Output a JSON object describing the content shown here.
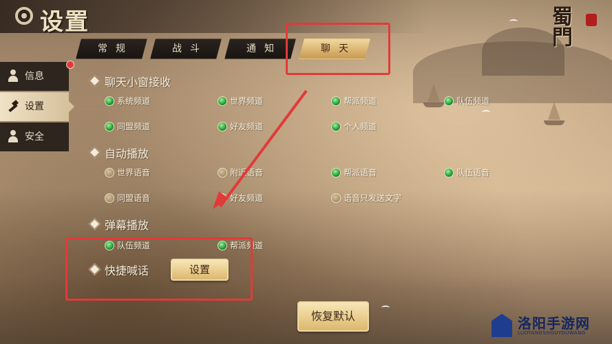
{
  "header": {
    "title": "设置",
    "logo_text": "蜀門"
  },
  "tabs": [
    {
      "label": "常规",
      "active": false
    },
    {
      "label": "战斗",
      "active": false
    },
    {
      "label": "通知",
      "active": false
    },
    {
      "label": "聊天",
      "active": true
    }
  ],
  "sidebar": {
    "items": [
      {
        "label": "信息",
        "icon": "person-icon",
        "active": false
      },
      {
        "label": "设置",
        "icon": "hammer-icon",
        "active": true
      },
      {
        "label": "安全",
        "icon": "users-icon",
        "active": false
      }
    ],
    "notification_dot": true
  },
  "sections": [
    {
      "title": "聊天小窗接收",
      "options": [
        {
          "label": "系统频道",
          "checked": true
        },
        {
          "label": "世界频道",
          "checked": true
        },
        {
          "label": "帮派频道",
          "checked": true
        },
        {
          "label": "队伍频道",
          "checked": true
        },
        {
          "label": "同盟频道",
          "checked": true
        },
        {
          "label": "好友频道",
          "checked": true
        },
        {
          "label": "个人频道",
          "checked": true
        }
      ]
    },
    {
      "title": "自动播放",
      "options": [
        {
          "label": "世界语音",
          "checked": false
        },
        {
          "label": "附近语音",
          "checked": false
        },
        {
          "label": "帮派语音",
          "checked": true
        },
        {
          "label": "队伍语音",
          "checked": true
        },
        {
          "label": "同盟语音",
          "checked": false
        },
        {
          "label": "好友频道",
          "checked": false
        },
        {
          "label": "语音只发送文字",
          "checked": false
        }
      ]
    },
    {
      "title": "弹幕播放",
      "options": [
        {
          "label": "队伍频道",
          "checked": true
        },
        {
          "label": "帮派频道",
          "checked": true
        }
      ]
    },
    {
      "title": "快捷喊话",
      "button_label": "设置"
    }
  ],
  "restore_button": "恢复默认",
  "watermark": {
    "title": "洛阳手游网",
    "subtitle": "LUOYANGSHOUYOUWANG"
  },
  "colors": {
    "highlight": "#e23a3a",
    "checked": "#1e9a32",
    "accent": "#dcb86e"
  }
}
